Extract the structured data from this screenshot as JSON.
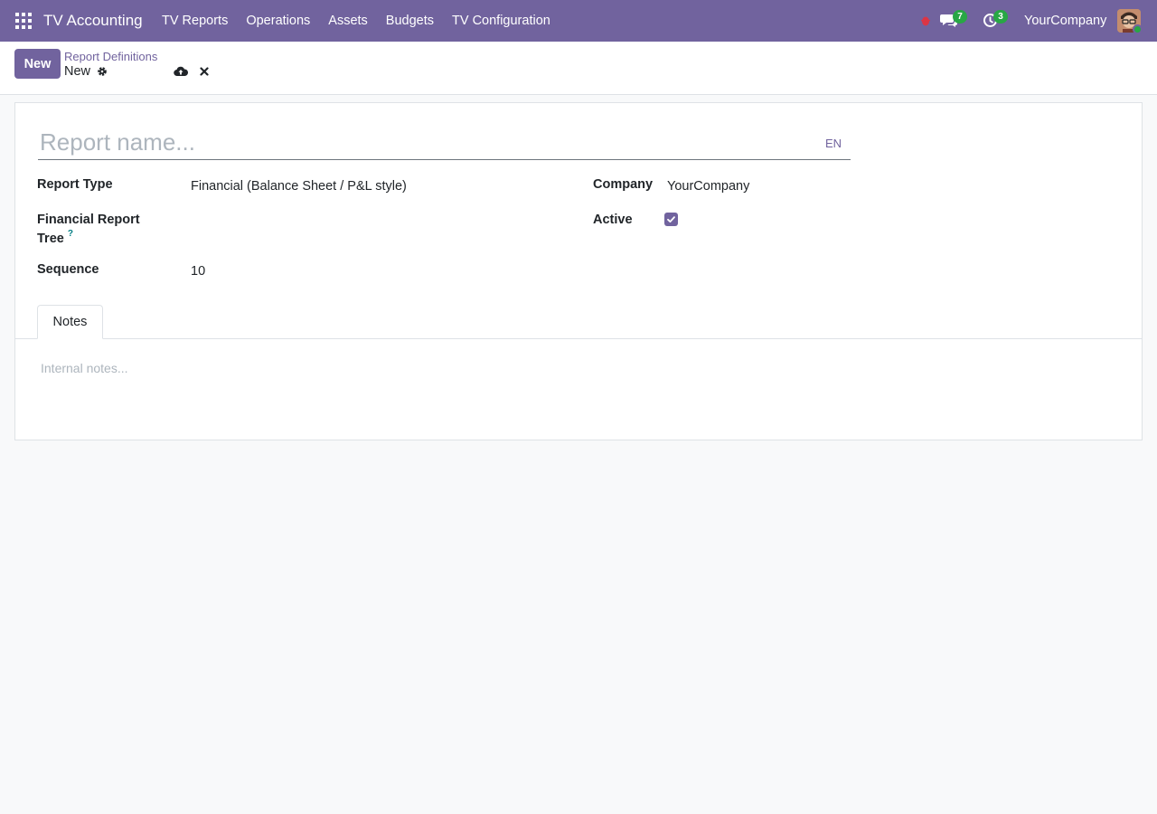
{
  "navbar": {
    "app_name": "TV Accounting",
    "menu": [
      "TV Reports",
      "Operations",
      "Assets",
      "Budgets",
      "TV Configuration"
    ],
    "chat_count": "7",
    "activity_count": "3",
    "company": "YourCompany",
    "colors": {
      "bar": "#71639e",
      "badge": "#28a745",
      "bug": "#dc3545"
    }
  },
  "control_panel": {
    "new_label": "New",
    "breadcrumb": "Report Definitions",
    "record_title": "New"
  },
  "form": {
    "name_placeholder": "Report name...",
    "lang": "EN",
    "report_type_label": "Report Type",
    "report_type_value": "Financial (Balance Sheet / P&L style)",
    "tree_label_line1": "Financial Report",
    "tree_label_line2": "Tree",
    "tree_help": "?",
    "sequence_label": "Sequence",
    "sequence_value": "10",
    "company_label": "Company",
    "company_value": "YourCompany",
    "active_label": "Active",
    "active_checked": true
  },
  "notebook": {
    "tab_notes": "Notes",
    "notes_placeholder": "Internal notes..."
  }
}
